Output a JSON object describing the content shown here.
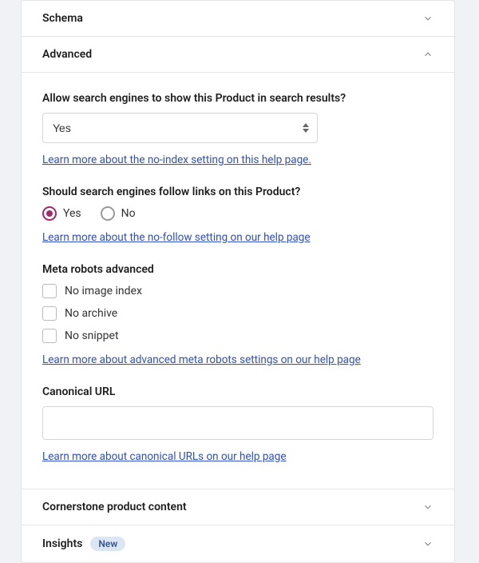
{
  "sections": {
    "schema": {
      "title": "Schema"
    },
    "advanced": {
      "title": "Advanced"
    },
    "cornerstone": {
      "title": "Cornerstone product content"
    },
    "insights": {
      "title": "Insights",
      "badge": "New"
    }
  },
  "advanced_form": {
    "search_show": {
      "label": "Allow search engines to show this Product in search results?",
      "value": "Yes",
      "help_link": "Learn more about the no-index setting on this help page."
    },
    "follow_links": {
      "label": "Should search engines follow links on this Product?",
      "options": {
        "yes": "Yes",
        "no": "No"
      },
      "selected": "yes",
      "help_link": "Learn more about the no-follow setting on our help page"
    },
    "meta_robots": {
      "label": "Meta robots advanced",
      "options": {
        "no_image_index": "No image index",
        "no_archive": "No archive",
        "no_snippet": "No snippet"
      },
      "help_link": "Learn more about advanced meta robots settings on our help page"
    },
    "canonical": {
      "label": "Canonical URL",
      "value": "",
      "help_link": "Learn more about canonical URLs on our help page"
    }
  }
}
